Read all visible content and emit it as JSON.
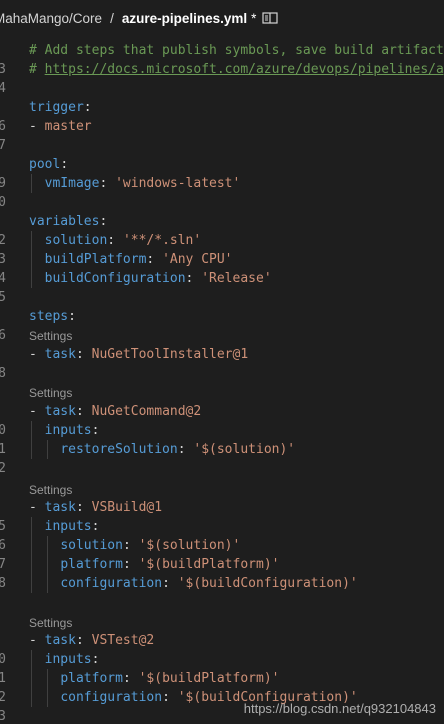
{
  "tab": {
    "repo_path": "MahaMango/Core",
    "separator": "/",
    "file_name": "azure-pipelines.yml",
    "dirty_marker": "*",
    "split_icon": "split-editor-icon"
  },
  "editor": {
    "comment1": "# Add steps that publish symbols, save build artifacts",
    "comment2_prefix": "# ",
    "comment2_link": "https://docs.microsoft.com/azure/devops/pipelines/ap",
    "trigger_key": "trigger",
    "trigger_item": "master",
    "pool_key": "pool",
    "vmimage_key": "vmImage",
    "vmimage_val": "'windows-latest'",
    "variables_key": "variables",
    "solution_key": "solution",
    "solution_val": "'**/*.sln'",
    "buildplatform_key": "buildPlatform",
    "buildplatform_val": "'Any CPU'",
    "buildconfig_key": "buildConfiguration",
    "buildconfig_val": "'Release'",
    "steps_key": "steps",
    "codelens": "Settings",
    "task_key": "task",
    "task1_val": "NuGetToolInstaller@1",
    "task2_val": "NuGetCommand@2",
    "inputs_key": "inputs",
    "restore_key": "restoreSolution",
    "restore_val": "'$(solution)'",
    "task3_val": "VSBuild@1",
    "sol_input_val": "'$(solution)'",
    "platform_key": "platform",
    "platform_val": "'$(buildPlatform)'",
    "configuration_key": "configuration",
    "configuration_val": "'$(buildConfiguration)'",
    "task4_val": "VSTest@2",
    "line_numbers": [
      "3",
      "4",
      "",
      "6",
      "7",
      "",
      "9",
      "0",
      "",
      "2",
      "3",
      "4",
      "5",
      "6",
      "",
      "8",
      "",
      "3",
      "",
      "0",
      "1",
      "2",
      "",
      "",
      "5",
      "6",
      "7",
      "8",
      "",
      "",
      "0",
      "1",
      "2",
      "3"
    ]
  },
  "watermark": "https://blog.csdn.net/q932104843"
}
